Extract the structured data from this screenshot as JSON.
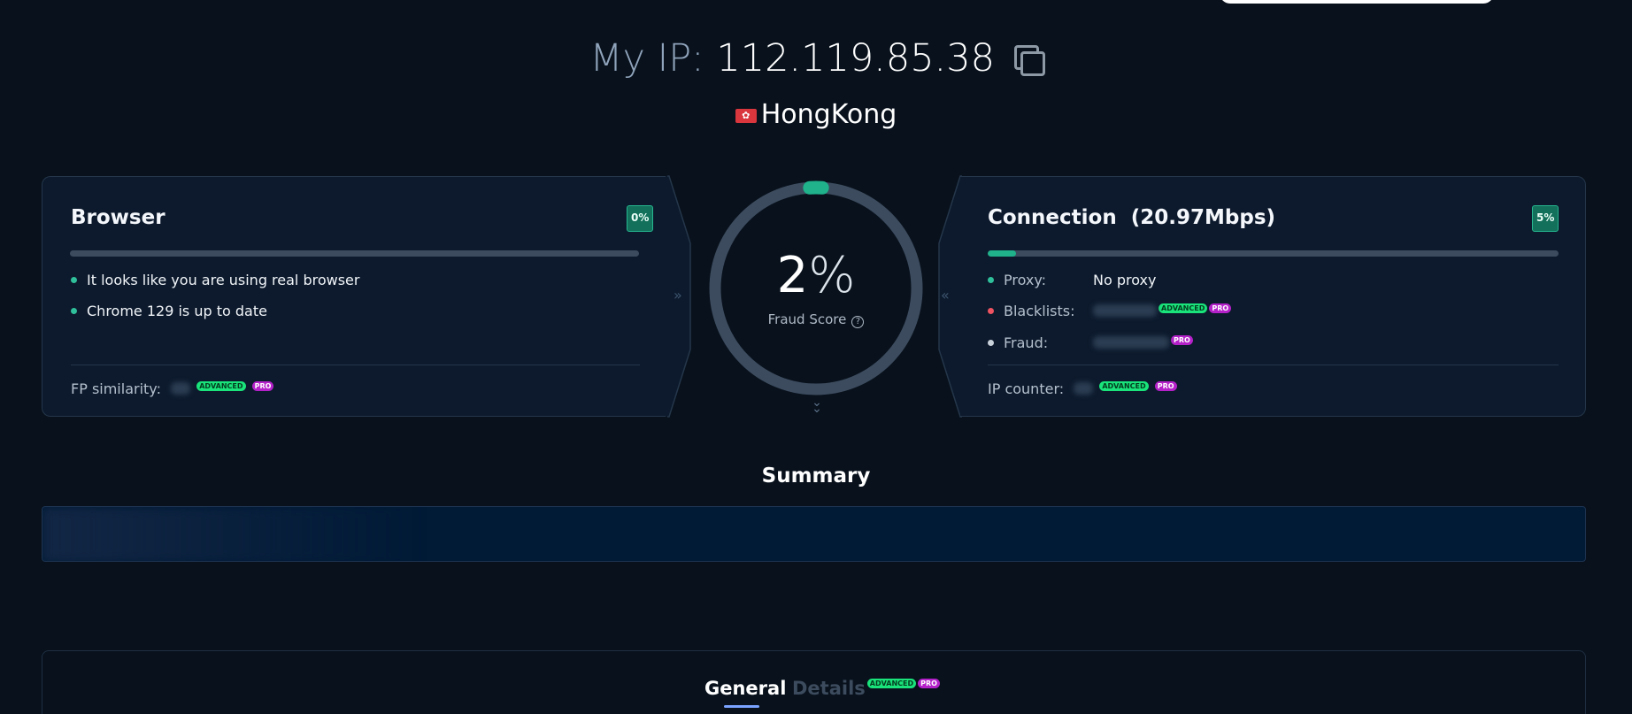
{
  "header": {
    "ip_label": "My IP:",
    "ip_value": "112.119.85.38",
    "location": "HongKong",
    "flag_icon": "hong-kong-flag-icon",
    "copy_icon": "copy-icon"
  },
  "browser": {
    "title": "Browser",
    "badge": "0%",
    "progress": 0,
    "checks": [
      "It looks like you are using real browser",
      "Chrome 129 is up to date"
    ],
    "fp_label": "FP similarity:",
    "tags": {
      "advanced": "ADVANCED",
      "pro": "PRO"
    }
  },
  "gauge": {
    "value": "2",
    "unit": "%",
    "label": "Fraud Score",
    "score": 2
  },
  "connection": {
    "title": "Connection",
    "speed": "(20.97Mbps)",
    "badge": "5%",
    "progress": 5,
    "proxy_label": "Proxy:",
    "proxy_value": "No proxy",
    "blacklists_label": "Blacklists:",
    "fraud_label": "Fraud:",
    "ip_counter_label": "IP counter:",
    "tags": {
      "advanced": "ADVANCED",
      "pro": "PRO"
    }
  },
  "summary": {
    "title": "Summary"
  },
  "tabs": {
    "general": "General",
    "details": "Details",
    "details_tags": {
      "advanced": "ADVANCED",
      "pro": "PRO"
    }
  },
  "colors": {
    "background": "#08111c",
    "card": "#0d1a2d",
    "accent_green": "#1fb28b",
    "red": "#ee5361",
    "tag_advanced": "#19e37a",
    "tag_pro": "#b421c9"
  }
}
